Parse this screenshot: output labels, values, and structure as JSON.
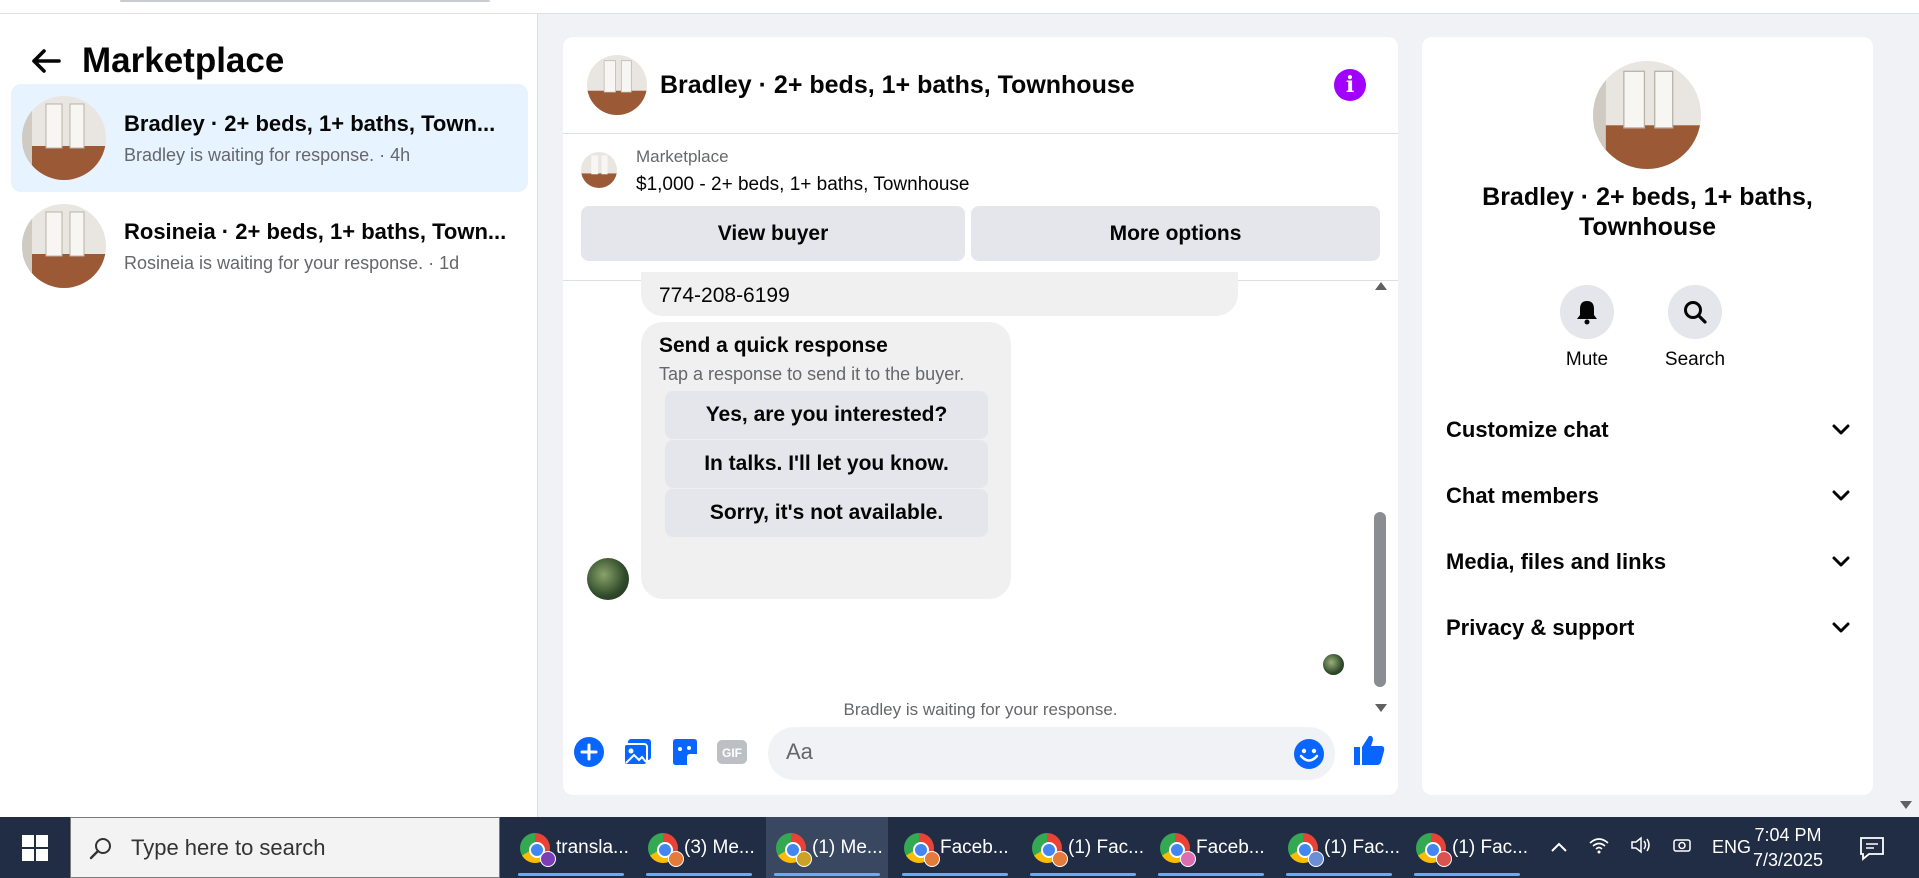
{
  "sidebar": {
    "title": "Marketplace",
    "conversations": [
      {
        "title": "Bradley · 2+ beds, 1+ baths, Town...",
        "subtitle": "Bradley is waiting for response. · 4h",
        "active": true
      },
      {
        "title": "Rosineia · 2+ beds, 1+ baths, Town...",
        "subtitle": "Rosineia is waiting for your response. · 1d",
        "active": false
      }
    ]
  },
  "chat": {
    "title": "Bradley · 2+ beds, 1+ baths, Townhouse",
    "listing": {
      "source": "Marketplace",
      "price_desc": "$1,000 - 2+ beds, 1+ baths, Townhouse",
      "view_buyer": "View buyer",
      "more_options": "More options"
    },
    "phone_message": "774-208-6199",
    "quick_response": {
      "title": "Send a quick response",
      "subtitle": "Tap a response to send it to the buyer.",
      "options": [
        "Yes, are you interested?",
        "In talks. I'll let you know.",
        "Sorry, it's not available."
      ]
    },
    "status": "Bradley is waiting for your response.",
    "composer": {
      "placeholder": "Aa"
    }
  },
  "details": {
    "name": "Bradley · 2+ beds, 1+ baths, Townhouse",
    "actions": [
      {
        "label": "Mute",
        "icon": "bell-icon"
      },
      {
        "label": "Search",
        "icon": "search-icon"
      }
    ],
    "sections": [
      "Customize chat",
      "Chat members",
      "Media, files and links",
      "Privacy & support"
    ]
  },
  "taskbar": {
    "search_placeholder": "Type here to search",
    "apps": [
      "transla...",
      "(3) Me...",
      "(1) Me...",
      "Faceb...",
      "(1) Fac...",
      "Faceb...",
      "(1) Fac...",
      "(1) Fac..."
    ],
    "language": "ENG",
    "time": "7:04 PM",
    "date": "7/3/2025"
  },
  "colors": {
    "accent": "#0866ff",
    "active_conv": "#e7f3ff",
    "info": "#a100ff",
    "taskbar": "#202d44"
  }
}
